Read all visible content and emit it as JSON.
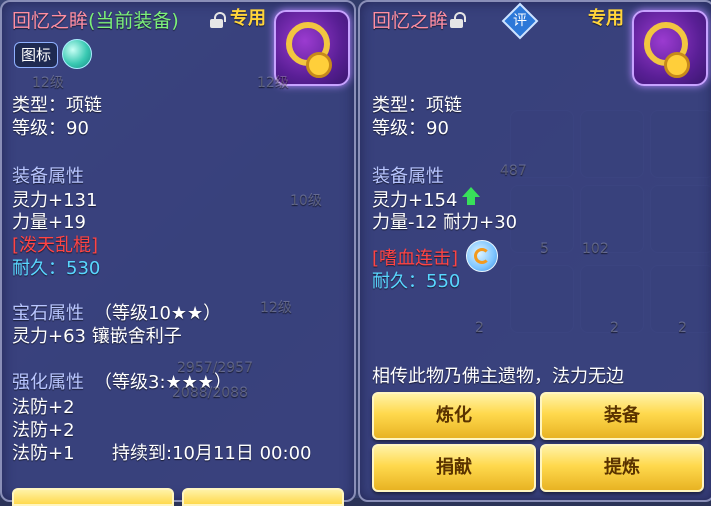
{
  "left": {
    "item_name": "回忆之眸",
    "equipped_tag": "(当前装备)",
    "exclusive_tag": "专用",
    "icon_label": "图标",
    "type_line": "类型：项链",
    "level_line": "等级：90",
    "attr_header": "装备属性",
    "attrs": [
      "灵力+131",
      "力量+19"
    ],
    "special_skill": "[泼天乱棍]",
    "durability": "耐久：530",
    "gem_header": "宝石属性",
    "gem_level": "（等级10★★）",
    "gem_line": "灵力+63 镶嵌舍利子",
    "enhance_header": "强化属性",
    "enhance_level": "（等级3:★★★）",
    "enhance_lines": [
      "法防+2",
      "法防+2",
      "法防+1"
    ],
    "duration": "持续到:10月11日 00:00"
  },
  "right": {
    "item_name": "回忆之眸",
    "rate_label": "评",
    "exclusive_tag": "专用",
    "type_line": "类型：项链",
    "level_line": "等级：90",
    "attr_header": "装备属性",
    "attr_1": "灵力+154",
    "attr_2": "力量-12 耐力+30",
    "special_skill": "[嗜血连击]",
    "durability": "耐久：550",
    "description": "相传此物乃佛主遗物，法力无边",
    "buttons": {
      "refine": "炼化",
      "equip": "装备",
      "donate": "捐献",
      "extract": "提炼"
    }
  },
  "background": {
    "slot_labels": [
      "12级",
      "12级",
      "10级",
      "487",
      "102",
      "5",
      "2",
      "2",
      "2",
      "12级"
    ],
    "hp_text": "2088/2088",
    "hp_text_2": "2957/2957"
  },
  "icons": [
    "lock-icon",
    "necklace-icon",
    "gem-orb-icon",
    "rating-diamond-icon",
    "arrow-up-icon",
    "refresh-icon"
  ],
  "colors": {
    "name_pink": "#ff8fa3",
    "equipped_green": "#7cf07a",
    "exclusive_gold": "#ffd43a",
    "section_blue": "#b9c6ff",
    "skill_red": "#ff4444",
    "durability_cyan": "#59d7ff",
    "button_gold": "#ffd94d"
  }
}
